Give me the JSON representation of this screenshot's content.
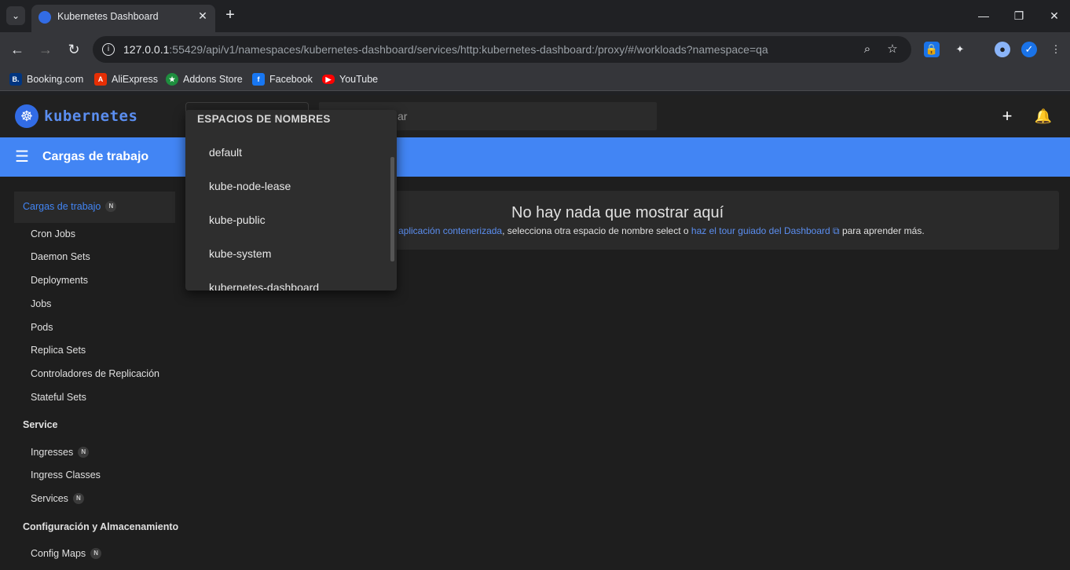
{
  "browser": {
    "tab_title": "Kubernetes Dashboard",
    "url_host": "127.0.0.1",
    "url_rest": ":55429/api/v1/namespaces/kubernetes-dashboard/services/http:kubernetes-dashboard:/proxy/#/workloads?namespace=qa",
    "bookmarks": [
      {
        "label": "Booking.com",
        "icon": "booking-icon",
        "color": "#003580"
      },
      {
        "label": "AliExpress",
        "icon": "aliexpress-icon",
        "color": "#e62e04"
      },
      {
        "label": "Addons Store",
        "icon": "addons-store-icon",
        "color": "#1e8e3e"
      },
      {
        "label": "Facebook",
        "icon": "facebook-icon",
        "color": "#1877f2"
      },
      {
        "label": "YouTube",
        "icon": "youtube-icon",
        "color": "#ff0000"
      }
    ]
  },
  "app": {
    "logo_text": "kubernetes",
    "search_placeholder": "ar",
    "page_title": "Cargas de trabajo",
    "accent_color": "#4285f4"
  },
  "sidebar": {
    "active": {
      "label": "Cargas de trabajo",
      "badge": "N"
    },
    "workloads": [
      "Cron Jobs",
      "Daemon Sets",
      "Deployments",
      "Jobs",
      "Pods",
      "Replica Sets",
      "Controladores de Replicación",
      "Stateful Sets"
    ],
    "service_group": "Service",
    "service_items": [
      {
        "label": "Ingresses",
        "badge": "N"
      },
      {
        "label": "Ingress Classes",
        "badge": ""
      },
      {
        "label": "Services",
        "badge": "N"
      }
    ],
    "config_group": "Configuración y Almacenamiento",
    "config_items": [
      {
        "label": "Config Maps",
        "badge": "N"
      }
    ]
  },
  "empty_state": {
    "title": "No hay nada que mostrar aquí",
    "link1": "aplicación contenerizada",
    "middle": ", selecciona otra espacio de nombre select o ",
    "link2": "haz el tour guiado del Dashboard",
    "ext_icon": "⧉",
    "tail": " para aprender más."
  },
  "namespace_dropdown": {
    "header": "ESPACIOS DE NOMBRES",
    "items": [
      "default",
      "kube-node-lease",
      "kube-public",
      "kube-system",
      "kubernetes-dashboard"
    ]
  }
}
